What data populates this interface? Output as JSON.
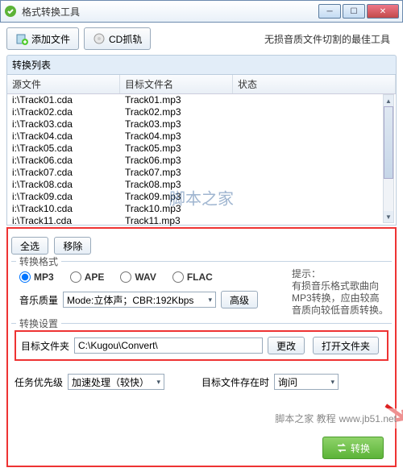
{
  "window": {
    "title": "格式转换工具",
    "subtitle": "无损音质文件切割的最佳工具"
  },
  "toolbar": {
    "add_file": "添加文件",
    "cd_rip": "CD抓轨"
  },
  "list": {
    "title": "转换列表",
    "col_source": "源文件",
    "col_target": "目标文件名",
    "col_status": "状态",
    "rows": [
      {
        "src": "i:\\Track01.cda",
        "dst": "Track01.mp3"
      },
      {
        "src": "i:\\Track02.cda",
        "dst": "Track02.mp3"
      },
      {
        "src": "i:\\Track03.cda",
        "dst": "Track03.mp3"
      },
      {
        "src": "i:\\Track04.cda",
        "dst": "Track04.mp3"
      },
      {
        "src": "i:\\Track05.cda",
        "dst": "Track05.mp3"
      },
      {
        "src": "i:\\Track06.cda",
        "dst": "Track06.mp3"
      },
      {
        "src": "i:\\Track07.cda",
        "dst": "Track07.mp3"
      },
      {
        "src": "i:\\Track08.cda",
        "dst": "Track08.mp3"
      },
      {
        "src": "i:\\Track09.cda",
        "dst": "Track09.mp3"
      },
      {
        "src": "i:\\Track10.cda",
        "dst": "Track10.mp3"
      },
      {
        "src": "i:\\Track11.cda",
        "dst": "Track11.mp3"
      }
    ]
  },
  "buttons": {
    "select_all": "全选",
    "remove": "移除",
    "advanced": "高级",
    "change": "更改",
    "open_folder": "打开文件夹",
    "convert": "转换"
  },
  "format": {
    "group_label": "转换格式",
    "options": {
      "mp3": "MP3",
      "ape": "APE",
      "wav": "WAV",
      "flac": "FLAC"
    },
    "hint_label": "提示：",
    "hint_text": "有损音乐格式歌曲向MP3转换，应由较高音质向较低音质转换。",
    "quality_label": "音乐质量",
    "quality_value": "Mode:立体声；CBR:192Kbps"
  },
  "settings": {
    "group_label": "转换设置",
    "target_label": "目标文件夹",
    "target_value": "C:\\Kugou\\Convert\\"
  },
  "priority": {
    "label": "任务优先级",
    "value": "加速处理（较快）",
    "exist_label": "目标文件存在时",
    "exist_value": "询问"
  },
  "footer": {
    "site": "www.jb51.net",
    "credit": "脚本之家 教程"
  },
  "watermark": "脚本之家"
}
